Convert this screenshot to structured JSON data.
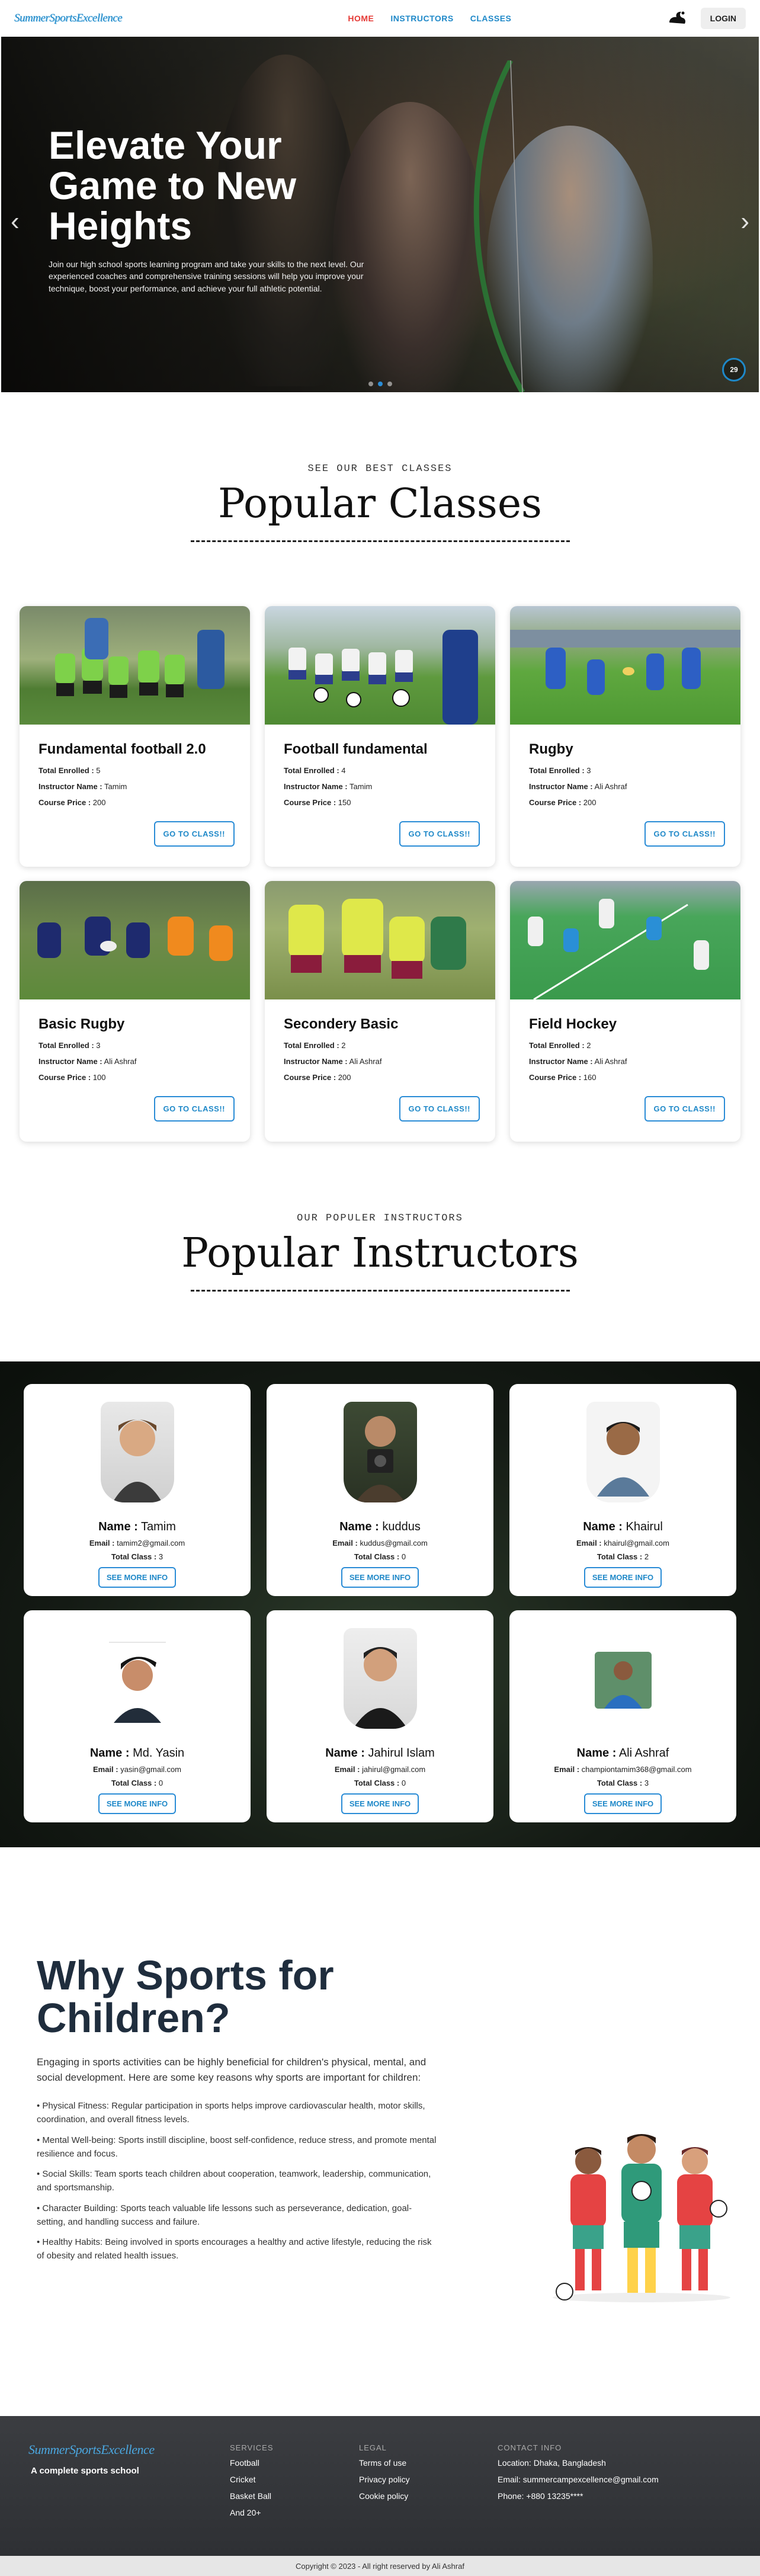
{
  "nav": {
    "brand": "SummerSportsExcellence",
    "links": [
      "HOME",
      "INSTRUCTORS",
      "CLASSES"
    ],
    "login": "LOGIN"
  },
  "hero": {
    "title": "Elevate Your Game to New Heights",
    "text": "Join our high school sports learning program and take your skills to the next level. Our experienced coaches and comprehensive training sessions will help you improve your technique, boost your performance, and achieve your full athletic potential.",
    "counter": "29"
  },
  "classes": {
    "kicker": "SEE OUR BEST CLASSES",
    "title": "Popular Classes",
    "label_enrolled": "Total Enrolled :",
    "label_instructor": "Instructor Name :",
    "label_price": "Course Price :",
    "button": "GO TO CLASS!!",
    "items": [
      {
        "name": "Fundamental football 2.0",
        "enrolled": "5",
        "instructor": "Tamim",
        "price": "200"
      },
      {
        "name": "Football fundamental",
        "enrolled": "4",
        "instructor": "Tamim",
        "price": "150"
      },
      {
        "name": "Rugby",
        "enrolled": "3",
        "instructor": "Ali Ashraf",
        "price": "200"
      },
      {
        "name": "Basic Rugby",
        "enrolled": "3",
        "instructor": "Ali Ashraf",
        "price": "100"
      },
      {
        "name": "Secondery Basic",
        "enrolled": "2",
        "instructor": "Ali Ashraf",
        "price": "200"
      },
      {
        "name": "Field Hockey",
        "enrolled": "2",
        "instructor": "Ali Ashraf",
        "price": "160"
      }
    ]
  },
  "instructors": {
    "kicker": "OUR POPULER INSTRUCTORS",
    "title": "Popular Instructors",
    "label_name": "Name :",
    "label_email": "Email :",
    "label_class": "Total Class :",
    "button": "SEE MORE INFO",
    "items": [
      {
        "name": "Tamim",
        "email": "tamim2@gmail.com",
        "classes": "3"
      },
      {
        "name": "kuddus",
        "email": "kuddus@gmail.com",
        "classes": "0"
      },
      {
        "name": "Khairul",
        "email": "khairul@gmail.com",
        "classes": "2"
      },
      {
        "name": "Md. Yasin",
        "email": "yasin@gmail.com",
        "classes": "0"
      },
      {
        "name": "Jahirul Islam",
        "email": "jahirul@gmail.com",
        "classes": "0"
      },
      {
        "name": "Ali Ashraf",
        "email": "championtamim368@gmail.com",
        "classes": "3"
      }
    ]
  },
  "why": {
    "title": "Why Sports for Children?",
    "intro": "Engaging in sports activities can be highly beneficial for children's physical, mental, and social development. Here are some key reasons why sports are important for children:",
    "items": [
      "Physical Fitness: Regular participation in sports helps improve cardiovascular health, motor skills, coordination, and overall fitness levels.",
      "Mental Well-being: Sports instill discipline, boost self-confidence, reduce stress, and promote mental resilience and focus.",
      "Social Skills: Team sports teach children about cooperation, teamwork, leadership, communication, and sportsmanship.",
      "Character Building: Sports teach valuable life lessons such as perseverance, dedication, goal-setting, and handling success and failure.",
      "Healthy Habits: Being involved in sports encourages a healthy and active lifestyle, reducing the risk of obesity and related health issues."
    ]
  },
  "footer": {
    "brand": "SummerSportsExcellence",
    "tagline": "A complete sports school",
    "services_title": "SERVICES",
    "services": [
      "Football",
      "Cricket",
      "Basket Ball",
      "And 20+"
    ],
    "legal_title": "LEGAL",
    "legal": [
      "Terms of use",
      "Privacy policy",
      "Cookie policy"
    ],
    "contact_title": "CONTACT INFO",
    "contact": [
      "Location: Dhaka, Bangladesh",
      "Email: summercampexcellence@gmail.com",
      "Phone: +880 13235****"
    ],
    "copyright": "Copyright © 2023 - All right reserved by Ali Ashraf"
  },
  "colors": {
    "accent": "#1e88c8",
    "active_nav": "#e53935",
    "heading_dark": "#1f2d3d"
  }
}
